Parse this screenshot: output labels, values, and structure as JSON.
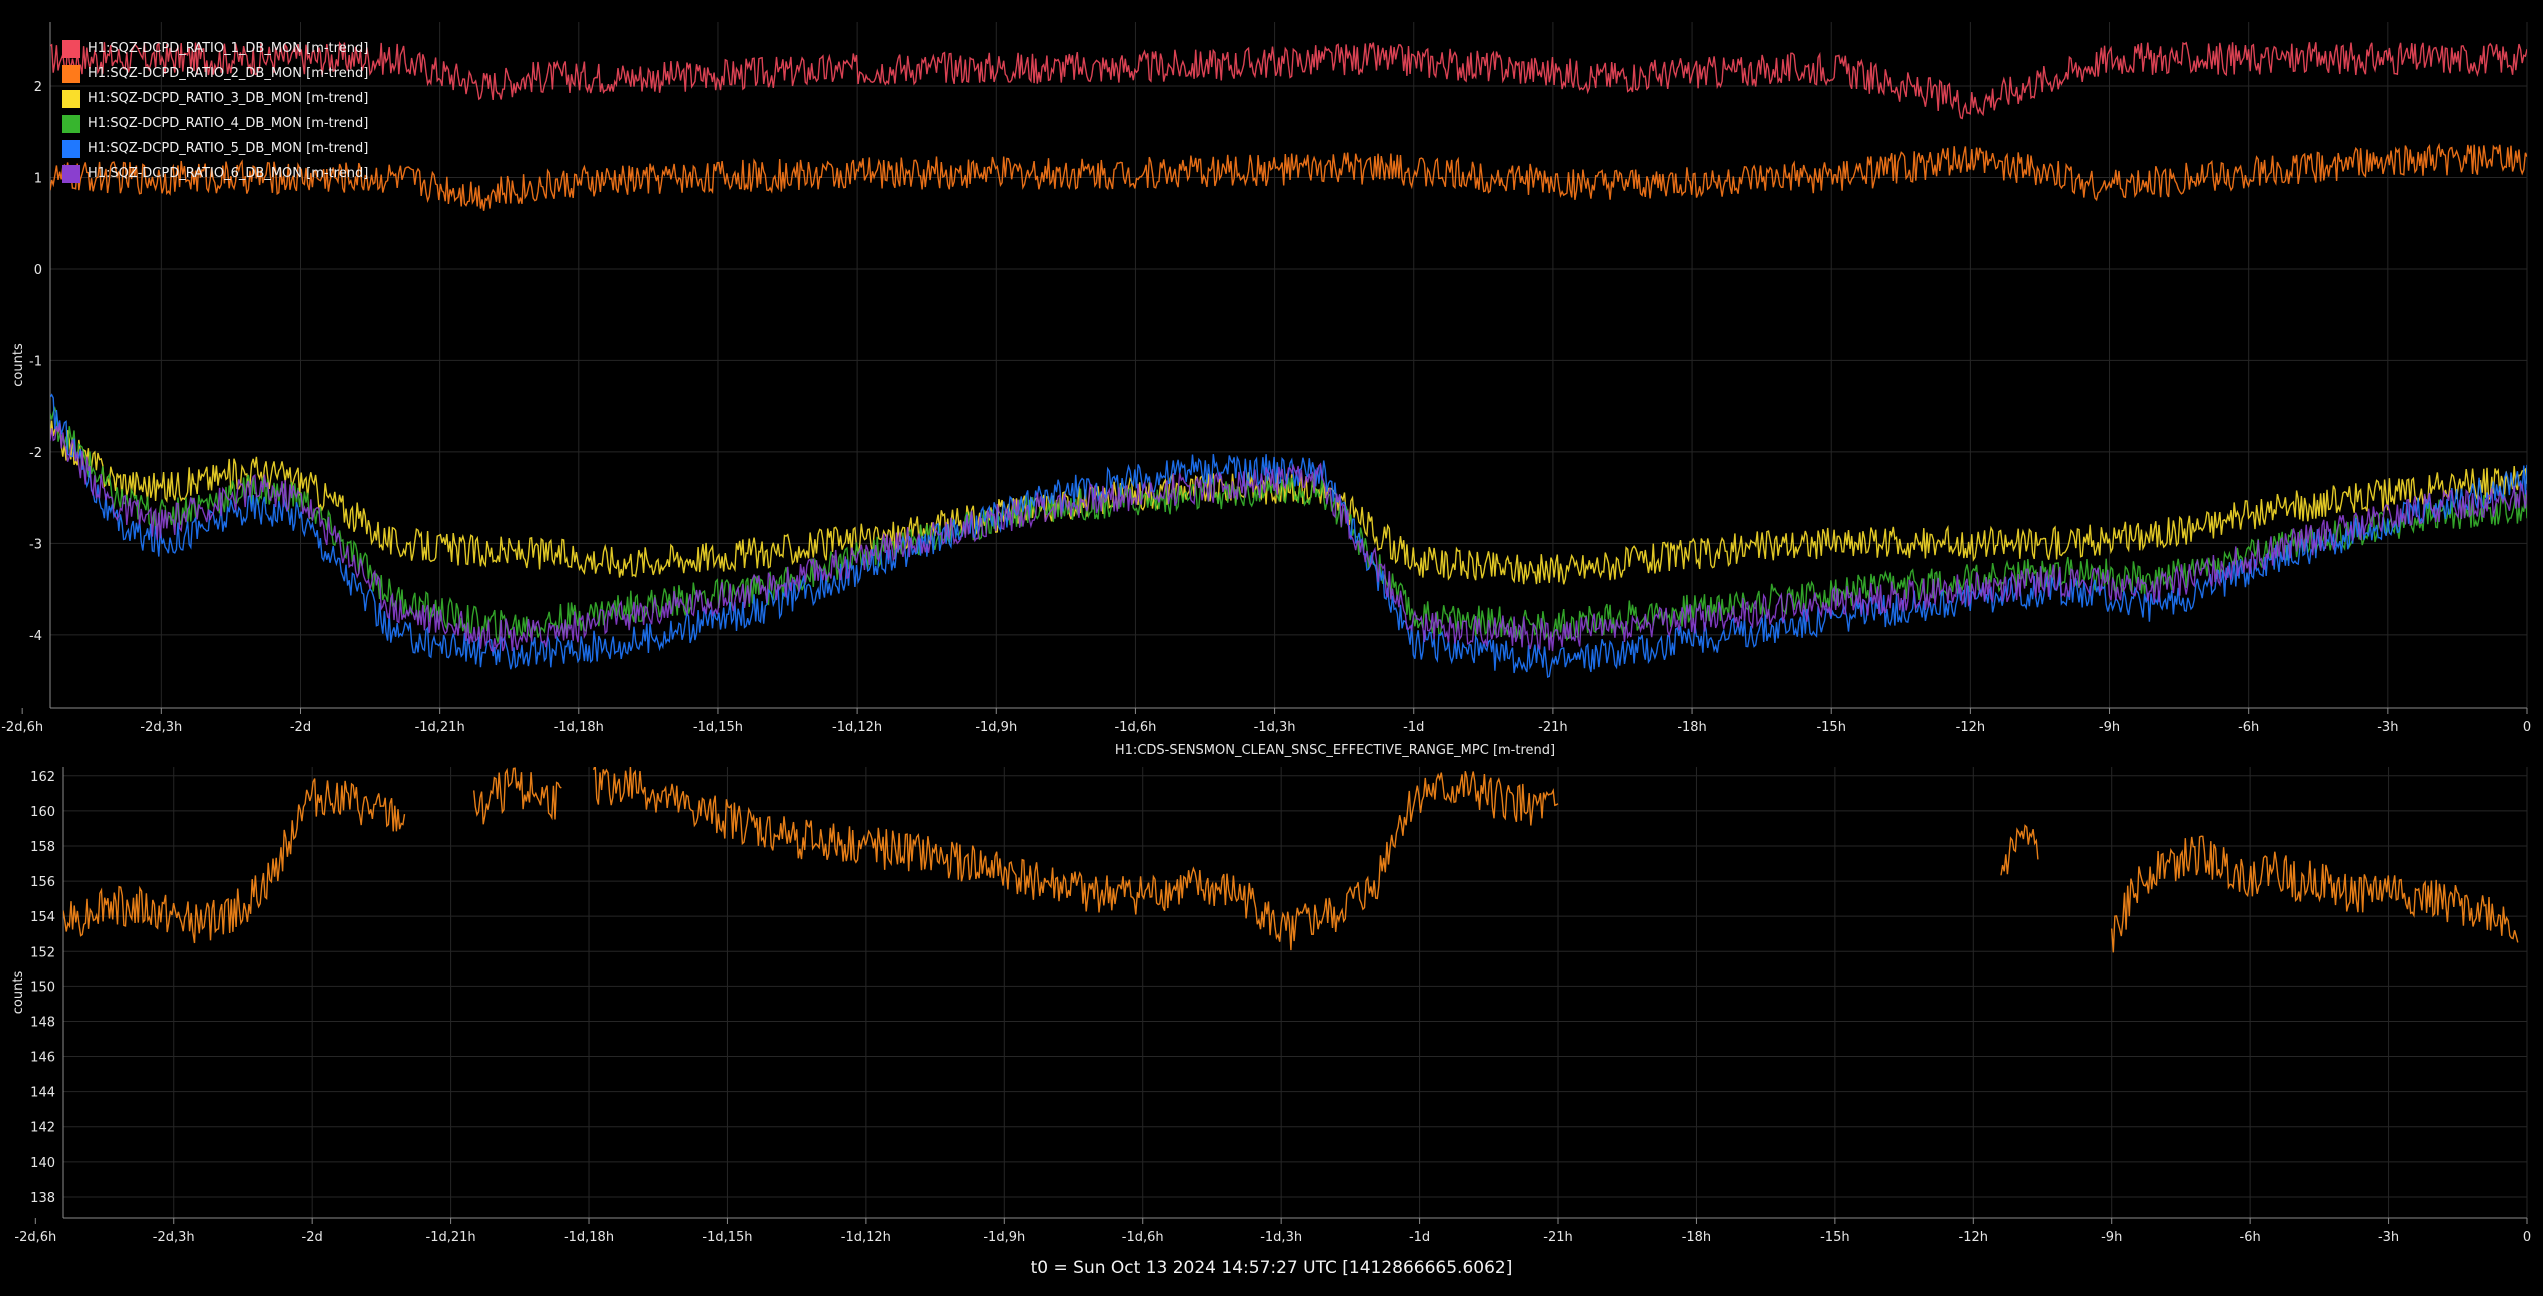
{
  "footer": {
    "t0_label": "t0 = Sun Oct 13 2024 14:57:27 UTC [1412866665.6062]"
  },
  "colors": {
    "background": "#000000",
    "grid": "#262626",
    "axis": "#8a8a8a",
    "text": "#e6e6e6"
  },
  "chart_data": [
    {
      "type": "line",
      "title": "",
      "xlabel": "",
      "ylabel": "counts",
      "x_unit": "hours relative to t0",
      "xlim": [
        -53.4,
        0
      ],
      "ylim": [
        -4.8,
        2.7
      ],
      "x_ticks": [
        {
          "x": -54,
          "label": "-2d,6h"
        },
        {
          "x": -51,
          "label": "-2d,3h"
        },
        {
          "x": -48,
          "label": "-2d"
        },
        {
          "x": -45,
          "label": "-1d,21h"
        },
        {
          "x": -42,
          "label": "-1d,18h"
        },
        {
          "x": -39,
          "label": "-1d,15h"
        },
        {
          "x": -36,
          "label": "-1d,12h"
        },
        {
          "x": -33,
          "label": "-1d,9h"
        },
        {
          "x": -30,
          "label": "-1d,6h"
        },
        {
          "x": -27,
          "label": "-1d,3h"
        },
        {
          "x": -24,
          "label": "-1d"
        },
        {
          "x": -21,
          "label": "-21h"
        },
        {
          "x": -18,
          "label": "-18h"
        },
        {
          "x": -15,
          "label": "-15h"
        },
        {
          "x": -12,
          "label": "-12h"
        },
        {
          "x": -9,
          "label": "-9h"
        },
        {
          "x": -6,
          "label": "-6h"
        },
        {
          "x": -3,
          "label": "-3h"
        },
        {
          "x": 0,
          "label": "0"
        }
      ],
      "y_ticks": [
        2,
        1,
        0,
        -1,
        -2,
        -3,
        -4
      ],
      "legend_position": "top-left",
      "series": [
        {
          "name": "H1:SQZ-DCPD_RATIO_1_DB_MON [m-trend]",
          "color": "#f2495c",
          "x": [
            -53.4,
            -50,
            -46,
            -44,
            -43,
            -40,
            -35,
            -30,
            -25,
            -22,
            -20,
            -15,
            -12,
            -9,
            -5,
            -2,
            0
          ],
          "y": [
            2.3,
            2.3,
            2.3,
            2.0,
            2.1,
            2.1,
            2.2,
            2.2,
            2.3,
            2.2,
            2.1,
            2.2,
            1.8,
            2.3,
            2.3,
            2.3,
            2.3
          ]
        },
        {
          "name": "H1:SQZ-DCPD_RATIO_2_DB_MON [m-trend]",
          "color": "#ff7a1a",
          "x": [
            -53.4,
            -50,
            -46,
            -44,
            -43,
            -40,
            -35,
            -30,
            -25,
            -22,
            -20,
            -15,
            -12,
            -9,
            -5,
            -2,
            0
          ],
          "y": [
            1.0,
            1.0,
            1.0,
            0.8,
            0.9,
            1.0,
            1.05,
            1.05,
            1.1,
            1.0,
            0.9,
            1.0,
            1.2,
            0.9,
            1.1,
            1.2,
            1.2
          ]
        },
        {
          "name": "H1:SQZ-DCPD_RATIO_3_DB_MON [m-trend]",
          "color": "#fade2a",
          "x": [
            -53.4,
            -52,
            -51,
            -49,
            -48,
            -46,
            -44,
            -43,
            -41,
            -38,
            -35,
            -32,
            -29,
            -26,
            -24,
            -21,
            -16,
            -12,
            -10,
            -8,
            -5,
            -2,
            0
          ],
          "y": [
            -1.8,
            -2.3,
            -2.4,
            -2.2,
            -2.3,
            -3.0,
            -3.1,
            -3.1,
            -3.2,
            -3.1,
            -2.9,
            -2.6,
            -2.4,
            -2.4,
            -3.2,
            -3.3,
            -3.0,
            -3.0,
            -3.0,
            -2.9,
            -2.6,
            -2.4,
            -2.3
          ]
        },
        {
          "name": "H1:SQZ-DCPD_RATIO_4_DB_MON [m-trend]",
          "color": "#37b52e",
          "x": [
            -53.4,
            -52,
            -51,
            -49,
            -48,
            -46,
            -44,
            -43,
            -41,
            -38,
            -35,
            -32,
            -29,
            -26,
            -24,
            -21,
            -16,
            -12,
            -10,
            -8,
            -5,
            -2,
            0
          ],
          "y": [
            -1.6,
            -2.5,
            -2.7,
            -2.4,
            -2.5,
            -3.6,
            -3.9,
            -3.9,
            -3.7,
            -3.5,
            -3.0,
            -2.6,
            -2.5,
            -2.4,
            -3.8,
            -3.9,
            -3.6,
            -3.4,
            -3.3,
            -3.4,
            -3.0,
            -2.7,
            -2.6
          ]
        },
        {
          "name": "H1:SQZ-DCPD_RATIO_5_DB_MON [m-trend]",
          "color": "#1f78ff",
          "x": [
            -53.4,
            -52,
            -51,
            -49,
            -48,
            -46,
            -44,
            -43,
            -41,
            -38,
            -35,
            -32,
            -29,
            -26,
            -24,
            -21,
            -16,
            -12,
            -10,
            -8,
            -5,
            -2,
            0
          ],
          "y": [
            -1.5,
            -2.8,
            -3.0,
            -2.6,
            -2.7,
            -4.0,
            -4.2,
            -4.2,
            -4.1,
            -3.7,
            -3.1,
            -2.5,
            -2.2,
            -2.2,
            -4.1,
            -4.3,
            -3.9,
            -3.6,
            -3.5,
            -3.7,
            -3.1,
            -2.6,
            -2.3
          ]
        },
        {
          "name": "H1:SQZ-DCPD_RATIO_6_DB_MON [m-trend]",
          "color": "#8a3fcf",
          "x": [
            -53.4,
            -52,
            -51,
            -49,
            -48,
            -46,
            -44,
            -43,
            -41,
            -38,
            -35,
            -32,
            -29,
            -26,
            -24,
            -21,
            -16,
            -12,
            -10,
            -8,
            -5,
            -2,
            0
          ],
          "y": [
            -1.7,
            -2.6,
            -2.8,
            -2.4,
            -2.5,
            -3.7,
            -4.0,
            -4.0,
            -3.8,
            -3.5,
            -3.0,
            -2.6,
            -2.4,
            -2.3,
            -3.9,
            -4.0,
            -3.7,
            -3.5,
            -3.4,
            -3.5,
            -3.0,
            -2.6,
            -2.5
          ]
        }
      ]
    },
    {
      "type": "line",
      "title": "H1:CDS-SENSMON_CLEAN_SNSC_EFFECTIVE_RANGE_MPC [m-trend]",
      "xlabel": "",
      "ylabel": "counts",
      "x_unit": "hours relative to t0",
      "xlim": [
        -53.4,
        0
      ],
      "ylim": [
        136.8,
        162.5
      ],
      "x_ticks": [
        {
          "x": -54,
          "label": "-2d,6h"
        },
        {
          "x": -51,
          "label": "-2d,3h"
        },
        {
          "x": -48,
          "label": "-2d"
        },
        {
          "x": -45,
          "label": "-1d,21h"
        },
        {
          "x": -42,
          "label": "-1d,18h"
        },
        {
          "x": -39,
          "label": "-1d,15h"
        },
        {
          "x": -36,
          "label": "-1d,12h"
        },
        {
          "x": -33,
          "label": "-1d,9h"
        },
        {
          "x": -30,
          "label": "-1d,6h"
        },
        {
          "x": -27,
          "label": "-1d,3h"
        },
        {
          "x": -24,
          "label": "-1d"
        },
        {
          "x": -21,
          "label": "-21h"
        },
        {
          "x": -18,
          "label": "-18h"
        },
        {
          "x": -15,
          "label": "-15h"
        },
        {
          "x": -12,
          "label": "-12h"
        },
        {
          "x": -9,
          "label": "-9h"
        },
        {
          "x": -6,
          "label": "-6h"
        },
        {
          "x": -3,
          "label": "-3h"
        },
        {
          "x": 0,
          "label": "0"
        }
      ],
      "y_ticks": [
        162,
        160,
        158,
        156,
        154,
        152,
        150,
        148,
        146,
        144,
        142,
        140,
        138
      ],
      "series": [
        {
          "color": "#ff8c1a",
          "segments": [
            {
              "x": [
                -53.4,
                -52.5,
                -51.5,
                -50.5,
                -49.5,
                -48.8,
                -48.2,
                -47.5,
                -46.8,
                -46.0
              ],
              "y": [
                153.5,
                154.8,
                154.3,
                153.5,
                154.5,
                156.5,
                160.5,
                161.0,
                160.0,
                159.5
              ]
            },
            {
              "x": [
                -44.5,
                -44.0,
                -43.5,
                -43.0,
                -42.6
              ],
              "y": [
                160.0,
                161.0,
                161.3,
                160.8,
                160.5
              ]
            },
            {
              "x": [
                -41.9,
                -41.0,
                -40.0,
                -39.0,
                -38.0,
                -37.0,
                -36.0,
                -35.0,
                -34.0,
                -33.0,
                -32.0,
                -31.0,
                -30.0,
                -29.0,
                -28.0,
                -27.5,
                -27.0,
                -26.0,
                -25.0,
                -24.5,
                -24.0,
                -23.0,
                -22.0,
                -21.0
              ],
              "y": [
                161.5,
                161.5,
                160.2,
                159.5,
                158.7,
                158.2,
                158.0,
                157.6,
                157.2,
                156.5,
                155.8,
                155.3,
                155.2,
                155.6,
                155.3,
                154.5,
                153.0,
                154.0,
                155.5,
                159.0,
                161.0,
                161.2,
                160.5,
                160.0
              ]
            },
            {
              "x": [
                -11.4,
                -11.0,
                -10.6
              ],
              "y": [
                156.5,
                158.5,
                157.8
              ]
            },
            {
              "x": [
                -9.0,
                -8.5,
                -8.0,
                -7.5,
                -7.0,
                -6.5,
                -6.0,
                -5.5,
                -5.0,
                -4.5,
                -4.0,
                -3.5,
                -3.0,
                -2.5,
                -2.0,
                -1.5,
                -1.0,
                -0.5,
                -0.2
              ],
              "y": [
                152.5,
                155.5,
                157.0,
                157.2,
                157.5,
                156.8,
                156.2,
                156.8,
                156.0,
                156.0,
                155.3,
                155.4,
                155.6,
                155.1,
                154.9,
                154.7,
                154.4,
                153.8,
                153.2
              ]
            }
          ]
        }
      ]
    }
  ]
}
